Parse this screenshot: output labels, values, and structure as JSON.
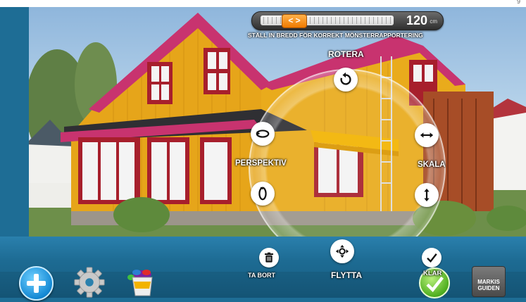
{
  "corner_text": "9",
  "slider": {
    "value": "120",
    "unit": "cm",
    "handle_glyph": "< >"
  },
  "instruction": "STÄLL IN BREDD FÖR KORREKT MÖNSTERRAPPORTERING",
  "controls": {
    "rotate": "ROTERA",
    "perspective": "PERSPEKTIV",
    "scale": "SKALA",
    "move": "FLYTTA",
    "delete": "TA BORT",
    "done": "KLAR"
  },
  "logo": {
    "line1": "MARKIS",
    "line2": "GUIDEN"
  },
  "icons": {
    "add": "plus-icon",
    "settings": "gear-icon",
    "paint": "paint-bucket-icon",
    "delete": "trash-icon",
    "done": "checkmark-icon"
  },
  "colors": {
    "accent": "#f07a00",
    "background": "#1e6d95",
    "awning": "#f2b300"
  }
}
